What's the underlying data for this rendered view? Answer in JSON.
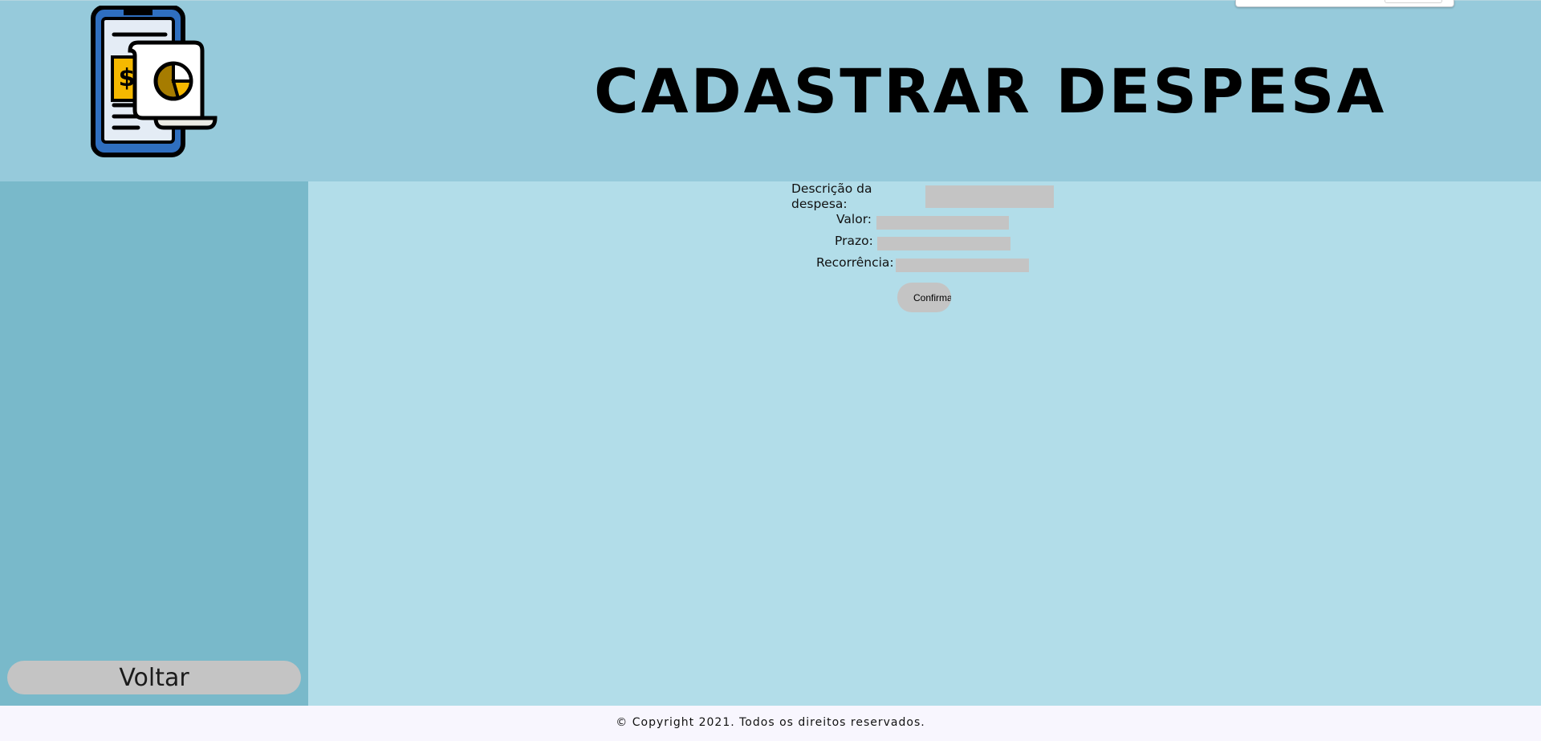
{
  "header": {
    "title": "CADASTRAR DESPESA",
    "logo_icon": "expense-receipt-phone-icon"
  },
  "sidebar": {
    "back_label": "Voltar"
  },
  "form": {
    "description_label": "Descrição da despesa:",
    "description_value": "",
    "amount_label": "Valor:",
    "amount_value": "",
    "deadline_label": "Prazo:",
    "deadline_value": "",
    "recurrence_label": "Recorrência:",
    "recurrence_value": "",
    "confirm_label": "Confirmar"
  },
  "footer": {
    "copyright": "© Copyright 2021. Todos os direitos reservados."
  },
  "colors": {
    "header_bg": "#96cadb",
    "sidebar_bg": "#79b9ca",
    "main_bg": "#b2dde9",
    "input_bg": "#c4c4c4",
    "footer_bg": "#f8f6fe"
  }
}
